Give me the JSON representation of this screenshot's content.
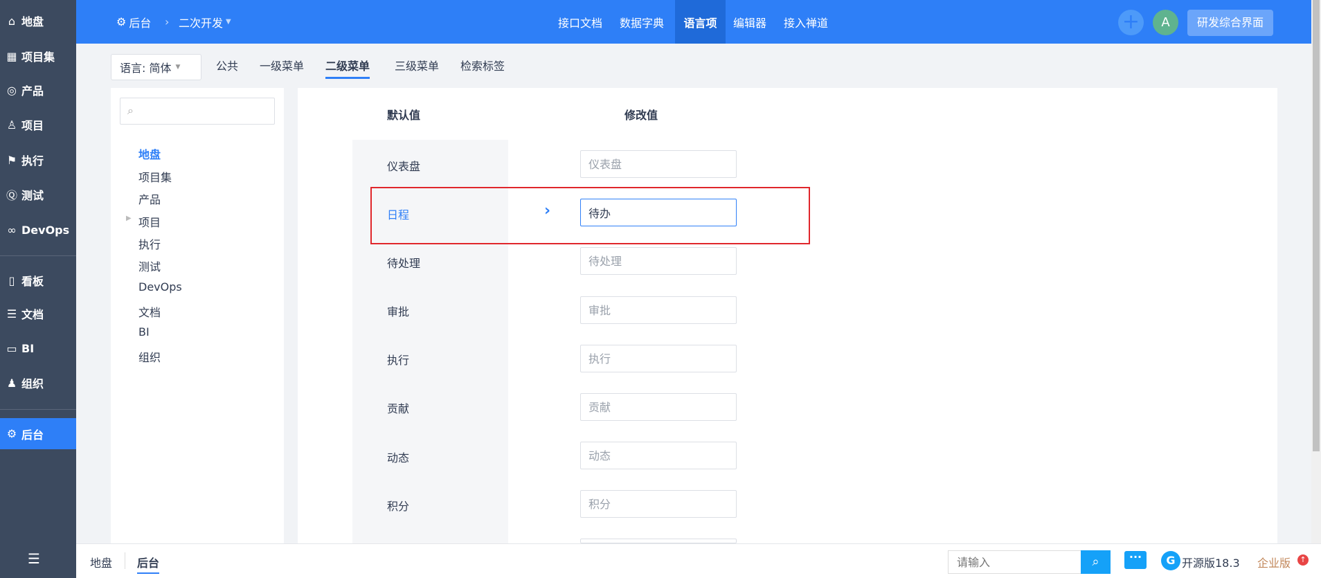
{
  "sidebar": {
    "items": [
      {
        "label": "地盘",
        "icon": "home-icon"
      },
      {
        "label": "项目集",
        "icon": "grid-icon"
      },
      {
        "label": "产品",
        "icon": "bulb-icon"
      },
      {
        "label": "项目",
        "icon": "rocket-icon"
      },
      {
        "label": "执行",
        "icon": "run-icon"
      },
      {
        "label": "测试",
        "icon": "bug-icon"
      },
      {
        "label": "DevOps",
        "icon": "infinity-icon"
      },
      {
        "label": "看板",
        "icon": "kanban-icon"
      },
      {
        "label": "文档",
        "icon": "doc-icon"
      },
      {
        "label": "BI",
        "icon": "chart-icon"
      },
      {
        "label": "组织",
        "icon": "people-icon"
      },
      {
        "label": "后台",
        "icon": "gear-icon",
        "active": true
      }
    ]
  },
  "header": {
    "breadcrumb_root": "后台",
    "breadcrumb_current": "二次开发",
    "nav": [
      {
        "label": "接口文档"
      },
      {
        "label": "数据字典"
      },
      {
        "label": "语言项",
        "active": true
      },
      {
        "label": "编辑器"
      },
      {
        "label": "接入禅道"
      }
    ],
    "avatar": "A",
    "workspace_button": "研发综合界面"
  },
  "subtabs": {
    "language_select": "语言: 简体",
    "tabs": [
      "公共",
      "一级菜单",
      "二级菜单",
      "三级菜单",
      "检索标签"
    ],
    "active": "二级菜单"
  },
  "tree": {
    "search_placeholder": "",
    "items": [
      "地盘",
      "项目集",
      "产品",
      "项目",
      "执行",
      "测试",
      "DevOps",
      "文档",
      "BI",
      "组织"
    ],
    "active": "地盘"
  },
  "table": {
    "col_default": "默认值",
    "col_modified": "修改值",
    "rows": [
      {
        "default": "仪表盘",
        "value": "",
        "placeholder": "仪表盘"
      },
      {
        "default": "日程",
        "value": "待办",
        "placeholder": "",
        "active": true
      },
      {
        "default": "待处理",
        "value": "",
        "placeholder": "待处理"
      },
      {
        "default": "审批",
        "value": "",
        "placeholder": "审批"
      },
      {
        "default": "执行",
        "value": "",
        "placeholder": "执行"
      },
      {
        "default": "贡献",
        "value": "",
        "placeholder": "贡献"
      },
      {
        "default": "动态",
        "value": "",
        "placeholder": "动态"
      },
      {
        "default": "积分",
        "value": "",
        "placeholder": "积分"
      }
    ]
  },
  "footer": {
    "breadcrumbs": [
      "地盘",
      "后台"
    ],
    "search_placeholder": "请输入",
    "version": "开源版18.3",
    "enterprise": "企业版"
  },
  "colors": {
    "primary": "#2e7ff7",
    "sidebar": "#3c4a5f",
    "highlight_box": "#e0262b"
  }
}
